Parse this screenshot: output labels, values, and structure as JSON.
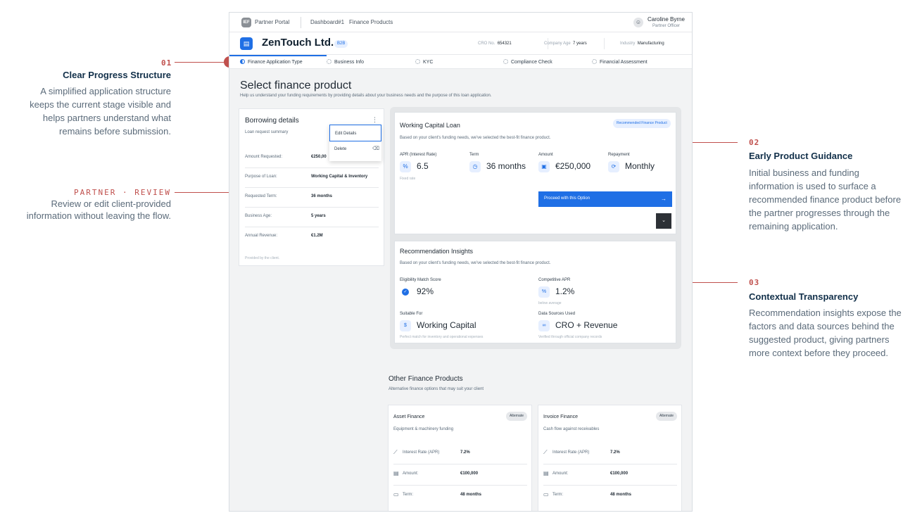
{
  "annotations": [
    {
      "number": "01",
      "title": "Clear Progress Structure",
      "body_lines": [
        "A simplified application structure",
        "keeps the current stage visible and",
        "helps partners understand what",
        "remains before submission."
      ]
    },
    {
      "title": "PARTNER · REVIEW",
      "body_lines": [
        "Review or edit client-provided",
        "information without leaving the flow."
      ]
    },
    {
      "number": "02",
      "title": "Early Product Guidance",
      "body_lines": [
        "Initial business and funding",
        "information is used to surface a",
        "recommended finance product before",
        "the partner progresses through the",
        "remaining application."
      ]
    },
    {
      "number": "03",
      "title": "Contextual Transparency",
      "body_lines": [
        "Recommendation insights expose the",
        "factors and data sources behind the",
        "suggested product, giving partners",
        "more context before they proceed."
      ]
    }
  ],
  "topbar": {
    "logo_text": "IEF",
    "portal_label": "Partner Portal",
    "breadcrumb": [
      "Dashboard#1",
      "Finance Products"
    ],
    "user_initial": "☺",
    "user_name": "Caroline Byrne",
    "user_role": "Partner Officer"
  },
  "company": {
    "name": "ZenTouch Ltd.",
    "badge": "B2B",
    "cro_label": "CRO No.",
    "cro_value": "654321",
    "age_label": "Company Age",
    "age_value": "7 years",
    "industry_label": "Industry",
    "industry_value": "Manufacturing"
  },
  "steps": [
    {
      "label": "Finance Application Type",
      "active": true
    },
    {
      "label": "Business Info",
      "active": false
    },
    {
      "label": "KYC",
      "active": false
    },
    {
      "label": "Compliance Check",
      "active": false
    },
    {
      "label": "Financial Assessment",
      "active": false
    }
  ],
  "page": {
    "title": "Select finance product",
    "subtitle": "Help us understand your funding requirements by providing details about your business needs and the purpose of this loan application."
  },
  "borrowing": {
    "title": "Borrowing details",
    "subtitle": "Loan request summary",
    "kebab": "⋮",
    "rows": [
      {
        "label": "Amount Requested:",
        "value": "€250,00"
      },
      {
        "label": "Purpose of Loan:",
        "value": "Working Capital & Inventory"
      },
      {
        "label": "Requested Term:",
        "value": "36 months"
      },
      {
        "label": "Business Age:",
        "value": "5 years"
      },
      {
        "label": "Annual Revenue:",
        "value": "€1.2M"
      }
    ],
    "footer": "Provided by the client.",
    "menu": {
      "edit": "Edit Details",
      "delete": "Delete"
    }
  },
  "recommended": {
    "title": "Working Capital Loan",
    "badge": "Recommended Finance Product",
    "subtitle": "Based on your client's funding needs, we've selected the best-fit finance product.",
    "metrics": [
      {
        "label": "APR (Interest Rate)",
        "value": "6.5",
        "note": "Fixed rate",
        "icon": "percent-icon"
      },
      {
        "label": "Term",
        "value": "36 months",
        "note": "",
        "icon": "clock-icon"
      },
      {
        "label": "Amount",
        "value": "€250,000",
        "note": "",
        "icon": "cash-icon"
      },
      {
        "label": "Repayment",
        "value": "Monthly",
        "note": "",
        "icon": "refresh-icon"
      }
    ],
    "proceed_label": "Proceed with this Option",
    "proceed_arrow": "→",
    "expand_glyph": "⌄"
  },
  "insights": {
    "title": "Recommendation Insights",
    "subtitle": "Based on your client's funding needs, we've selected the best-fit finance product.",
    "items": [
      {
        "label": "Eligibility Match Score",
        "value": "92%",
        "note": "",
        "icon": "check-circle-icon"
      },
      {
        "label": "Competitive APR",
        "value": "1.2%",
        "note": "below average",
        "icon": "percent-icon"
      },
      {
        "label": "Suitable For",
        "value": "Working Capital",
        "note": "Perfect match for inventory and operational expenses",
        "icon": "dollar-icon"
      },
      {
        "label": "Data Sources Used",
        "value": "CRO + Revenue",
        "note": "Verified through official company records",
        "icon": "link-icon"
      }
    ]
  },
  "other": {
    "title": "Other Finance Products",
    "subtitle": "Alternative finance options that may suit your client",
    "products": [
      {
        "name": "Asset Finance",
        "badge": "Alternate",
        "description": "Equipment & machinery funding",
        "rows": [
          {
            "label": "Interest Rate (APR)",
            "value": "7.2%"
          },
          {
            "label": "Amount:",
            "value": "€100,000"
          },
          {
            "label": "Term:",
            "value": "48 months"
          }
        ]
      },
      {
        "name": "Invoice Finance",
        "badge": "Alternate",
        "description": "Cash flow against receivables",
        "rows": [
          {
            "label": "Interest Rate (APR)",
            "value": "7.2%"
          },
          {
            "label": "Amount:",
            "value": "€100,000"
          },
          {
            "label": "Term:",
            "value": "48 months"
          }
        ]
      }
    ]
  },
  "colors": {
    "accent": "#1f6fe5",
    "annotation": "#c0504d",
    "heading": "#12304a"
  }
}
